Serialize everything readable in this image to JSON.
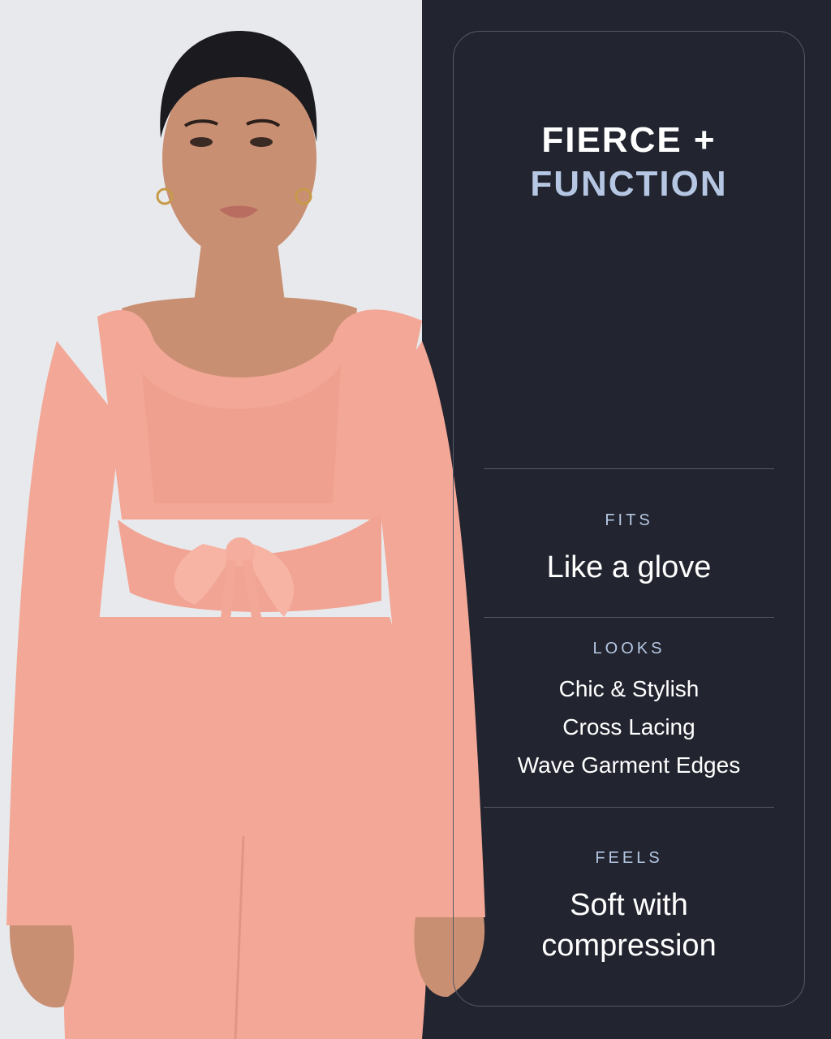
{
  "headline": {
    "line1": "FIERCE +",
    "line2": "FUNCTION"
  },
  "sections": [
    {
      "label": "FITS",
      "values": [
        "Like a glove"
      ]
    },
    {
      "label": "LOOKS",
      "values": [
        "Chic & Stylish",
        "Cross Lacing",
        "Wave Garment Edges"
      ]
    },
    {
      "label": "FEELS",
      "values": [
        "Soft with",
        "compression"
      ]
    }
  ],
  "colors": {
    "panel_bg": "#22242f",
    "accent": "#b6c7e3",
    "outfit": "#f3a796",
    "skin": "#c98f72"
  }
}
